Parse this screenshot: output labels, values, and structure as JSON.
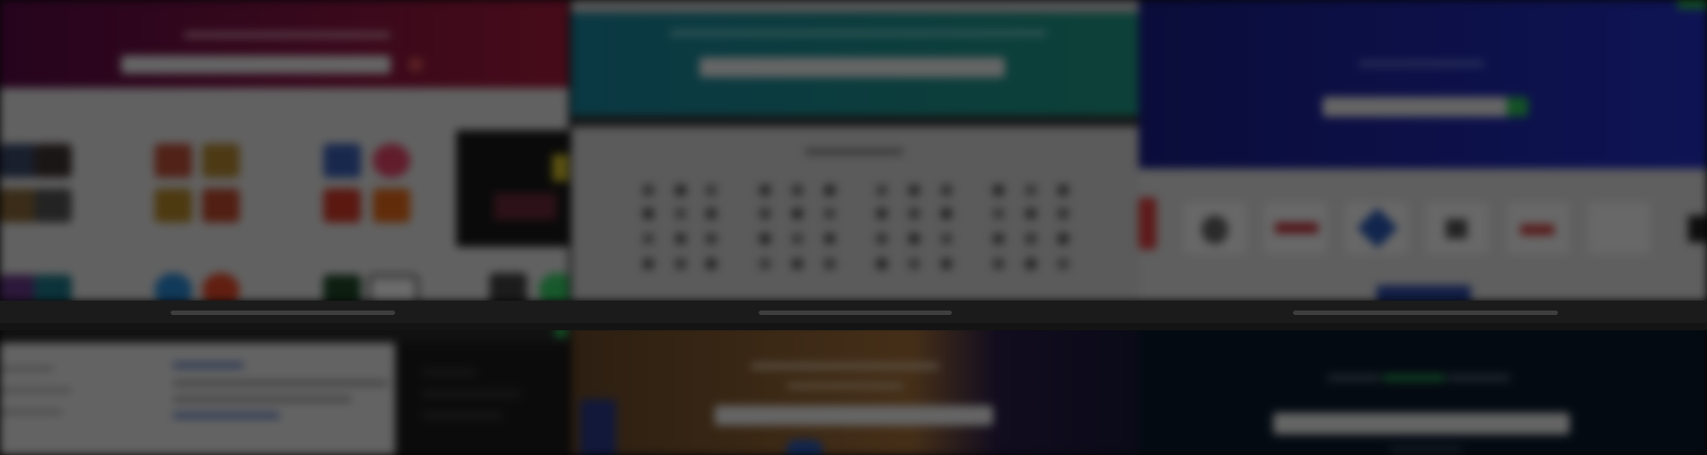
{
  "theme": {
    "tile1_banner": "#8a0f3c",
    "tile2_banner": "#1f8f96",
    "tile3_banner": "#1b24a8",
    "tile6_background": "#0a1a2c",
    "accent_green": "#30c25a",
    "overlay": "rgba(0,0,0,0.58)"
  },
  "tiles": [
    {
      "name": "app-store-collage",
      "icon": "app-grid-icon"
    },
    {
      "name": "icon-grid-page",
      "icon": "icon-grid-icon"
    },
    {
      "name": "brand-logo-page",
      "icon": "logo-icon"
    },
    {
      "name": "code-editor-page",
      "icon": "code-icon"
    },
    {
      "name": "photo-landing-page",
      "icon": "image-icon"
    },
    {
      "name": "dark-search-page",
      "icon": "search-icon"
    }
  ]
}
